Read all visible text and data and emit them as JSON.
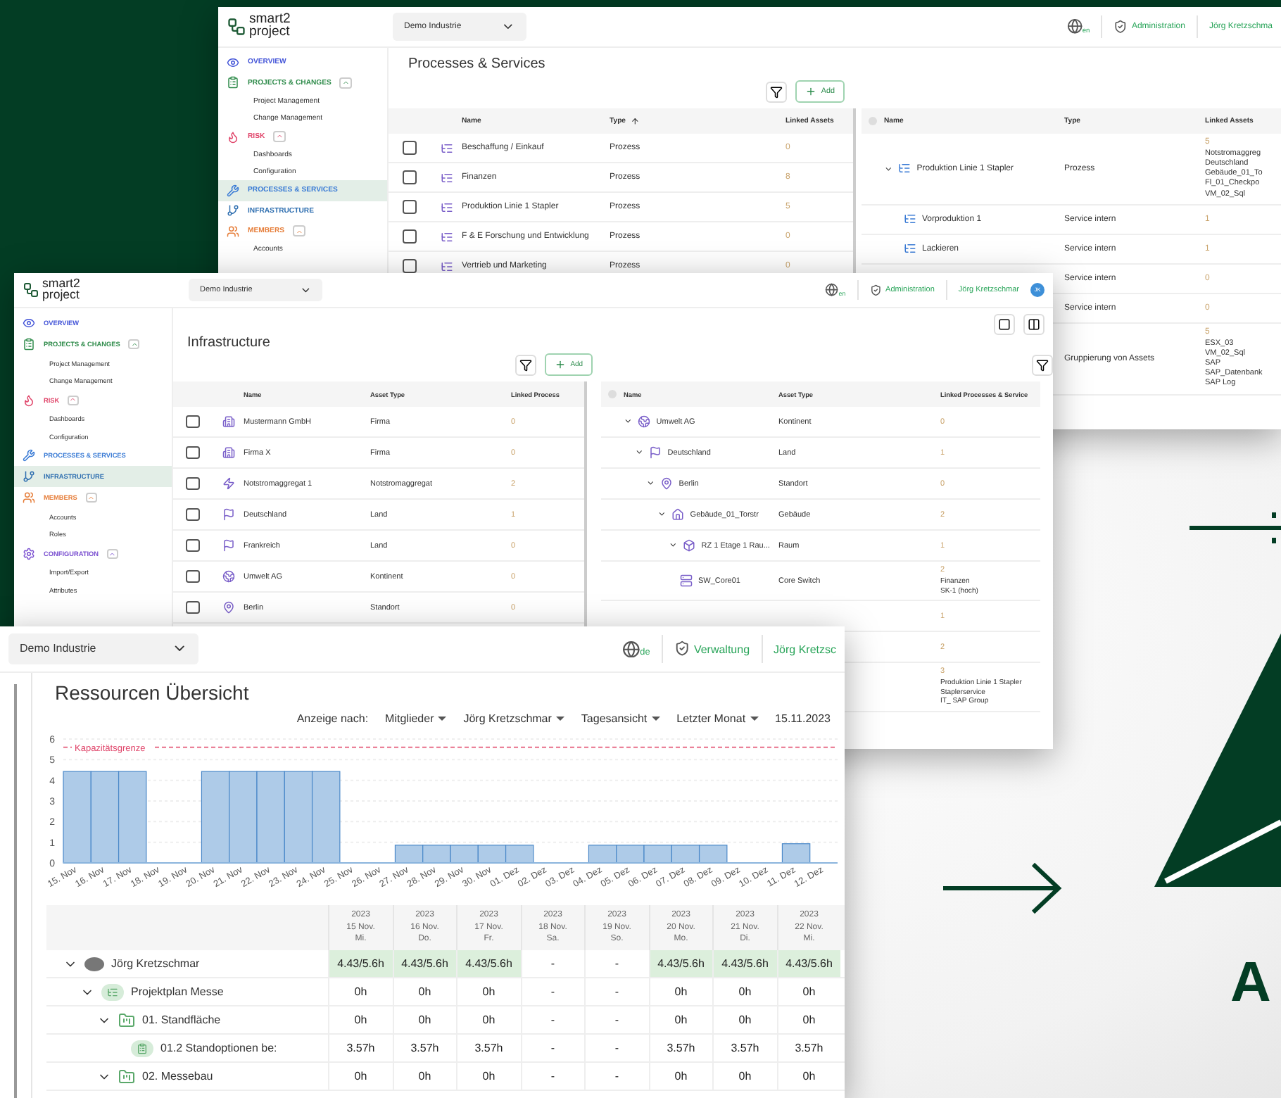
{
  "backdrop": {
    "brand_letter": "A"
  },
  "processes_window": {
    "topbar": {
      "logo": [
        "smart2",
        "project"
      ],
      "workspace": "Demo Industrie",
      "language": "en",
      "admin": "Administration",
      "user": "Jörg Kretzschma"
    },
    "sidebar": [
      {
        "label": "OVERVIEW",
        "color": "#4455d8",
        "selected": false
      },
      {
        "label": "PROJECTS & CHANGES",
        "color": "#2e8b4a",
        "selected": false,
        "expanded": true,
        "children": [
          {
            "label": "Project Management",
            "selected": false
          },
          {
            "label": "Change Management",
            "selected": false
          }
        ]
      },
      {
        "label": "RISK",
        "color": "#e0456a",
        "selected": false,
        "expanded": true,
        "children": [
          {
            "label": "Dashboards",
            "selected": false
          },
          {
            "label": "Configuration",
            "selected": false
          }
        ]
      },
      {
        "label": "PROCESSES & SERVICES",
        "color": "#3a7bd5",
        "selected": true
      },
      {
        "label": "INFRASTRUCTURE",
        "color": "#2f6fb0",
        "selected": false
      },
      {
        "label": "MEMBERS",
        "color": "#e67e3a",
        "selected": false,
        "expanded": true,
        "children": [
          {
            "label": "Accounts",
            "selected": false
          }
        ]
      }
    ],
    "title": "Processes & Services",
    "add_label": "Add",
    "left_table": {
      "columns": [
        {
          "label": "Name",
          "sorted": false
        },
        {
          "label": "Type",
          "sorted": true
        },
        {
          "label": "Linked Assets",
          "sorted": false
        }
      ],
      "rows": [
        {
          "checked": false,
          "name": "Beschaffung / Einkauf",
          "type": "Prozess",
          "linked": "0"
        },
        {
          "checked": false,
          "name": "Finanzen",
          "type": "Prozess",
          "linked": "8"
        },
        {
          "checked": false,
          "name": "Produktion Linie 1 Stapler",
          "type": "Prozess",
          "linked": "5"
        },
        {
          "checked": false,
          "name": "F & E Forschung und Entwicklung",
          "type": "Prozess",
          "linked": "0"
        },
        {
          "checked": false,
          "name": "Vertrieb und Marketing",
          "type": "Prozess",
          "linked": "0"
        }
      ]
    },
    "right_table": {
      "columns": [
        "Name",
        "Type",
        "Linked Assets"
      ],
      "rows": [
        {
          "kind": "process",
          "name": "Produktion Linie 1 Stapler",
          "type": "Prozess",
          "linked": "5",
          "linked_items": [
            "Notstromaggreg",
            "Deutschland",
            "Gebäude_01_To",
            "Fl_01_Checkpo",
            "VM_02_Sql"
          ],
          "expanded": true,
          "children": [
            {
              "kind": "service",
              "name": "Vorproduktion 1",
              "type": "Service intern",
              "linked": "1"
            },
            {
              "kind": "service",
              "name": "Lackieren",
              "type": "Service intern",
              "linked": "1"
            },
            {
              "kind": "hidden",
              "type": "Service intern",
              "linked": "0"
            },
            {
              "kind": "hidden",
              "type": "Service intern",
              "linked": "0"
            }
          ]
        },
        {
          "kind": "hidden",
          "type": "Gruppierung von Assets",
          "linked": "5",
          "linked_items": [
            "ESX_03",
            "VM_02_Sql",
            "SAP",
            "SAP_Datenbank",
            "SAP Log"
          ]
        }
      ]
    }
  },
  "infrastructure_window": {
    "topbar": {
      "logo": [
        "smart2",
        "project"
      ],
      "workspace": "Demo Industrie",
      "language": "en",
      "admin": "Administration",
      "user": "Jörg Kretzschmar",
      "avatar": "JK"
    },
    "sidebar": [
      {
        "label": "OVERVIEW",
        "color": "#4455d8",
        "selected": false
      },
      {
        "label": "PROJECTS & CHANGES",
        "color": "#2e8b4a",
        "selected": false,
        "expanded": true,
        "children": [
          {
            "label": "Project Management",
            "selected": false
          },
          {
            "label": "Change Management",
            "selected": false
          }
        ]
      },
      {
        "label": "RISK",
        "color": "#e0456a",
        "selected": false,
        "expanded": true,
        "children": [
          {
            "label": "Dashboards",
            "selected": false
          },
          {
            "label": "Configuration",
            "selected": false
          }
        ]
      },
      {
        "label": "PROCESSES & SERVICES",
        "color": "#3a7bd5",
        "selected": false
      },
      {
        "label": "INFRASTRUCTURE",
        "color": "#2f6fb0",
        "selected": true
      },
      {
        "label": "MEMBERS",
        "color": "#e67e3a",
        "selected": false,
        "expanded": true,
        "children": [
          {
            "label": "Accounts",
            "selected": false
          },
          {
            "label": "Roles",
            "selected": false
          }
        ]
      },
      {
        "label": "CONFIGURATION",
        "color": "#7a4fd0",
        "selected": false,
        "expanded": true,
        "children": [
          {
            "label": "Import/Export",
            "selected": false
          },
          {
            "label": "Attributes",
            "selected": false
          }
        ]
      }
    ],
    "title": "Infrastructure",
    "add_label": "Add",
    "left_table": {
      "columns": [
        {
          "label": "Name",
          "sorted": false
        },
        {
          "label": "Asset Type",
          "sorted": false
        },
        {
          "label": "Linked Process",
          "sorted": false
        }
      ],
      "rows": [
        {
          "checked": false,
          "kind": "company",
          "name": "Mustermann GmbH",
          "type": "Firma",
          "linked": "0"
        },
        {
          "checked": false,
          "kind": "company",
          "name": "Firma X",
          "type": "Firma",
          "linked": "0"
        },
        {
          "checked": false,
          "kind": "generator",
          "name": "Notstromaggregat 1",
          "type": "Notstromaggregat",
          "linked": "2"
        },
        {
          "checked": false,
          "kind": "country",
          "name": "Deutschland",
          "type": "Land",
          "linked": "1"
        },
        {
          "checked": false,
          "kind": "country",
          "name": "Frankreich",
          "type": "Land",
          "linked": "0"
        },
        {
          "checked": false,
          "kind": "continent",
          "name": "Umwelt AG",
          "type": "Kontinent",
          "linked": "0"
        },
        {
          "checked": false,
          "kind": "site",
          "name": "Berlin",
          "type": "Standort",
          "linked": "0"
        }
      ]
    },
    "right_table": {
      "columns": [
        "Name",
        "Asset Type",
        "Linked Processes & Service"
      ],
      "rows": [
        {
          "kind": "continent",
          "name": "Umwelt AG",
          "type": "Kontinent",
          "linked": "0",
          "expanded": true,
          "children": [
            {
              "kind": "country",
              "name": "Deutschland",
              "type": "Land",
              "linked": "1",
              "expanded": true,
              "children": [
                {
                  "kind": "site",
                  "name": "Berlin",
                  "type": "Standort",
                  "linked": "0",
                  "expanded": true,
                  "children": [
                    {
                      "kind": "building",
                      "name": "Gebäude_01_Torstr",
                      "type": "Gebäude",
                      "linked": "2",
                      "expanded": true,
                      "children": [
                        {
                          "kind": "room",
                          "name": "RZ 1 Etage 1 Rau...",
                          "type": "Raum",
                          "linked": "1",
                          "expanded": true,
                          "children": [
                            {
                              "kind": "switch",
                              "name": "SW_Core01",
                              "type": "Core Switch",
                              "linked": "2",
                              "linked_items": [
                                "Finanzen",
                                "SK-1 (hoch)"
                              ]
                            }
                          ]
                        }
                      ]
                    }
                  ]
                }
              ]
            }
          ]
        },
        {
          "kind": "hidden",
          "linked": "1"
        },
        {
          "kind": "hidden",
          "linked": "2"
        },
        {
          "kind": "hidden",
          "linked": "3",
          "linked_items": [
            "Produktion Linie 1 Stapler",
            "Staplerservice",
            "IT_ SAP Group"
          ]
        }
      ]
    }
  },
  "resources_window": {
    "topbar": {
      "workspace": "Demo Industrie",
      "language": "de",
      "admin": "Verwaltung",
      "user": "Jörg Kretzsc"
    },
    "title": "Ressourcen Übersicht",
    "filter_label": "Anzeige nach:",
    "filters": [
      {
        "label": "Mitglieder",
        "dropdown": true
      },
      {
        "label": "Jörg Kretzschmar",
        "dropdown": true
      },
      {
        "label": "Tagesansicht",
        "dropdown": true
      },
      {
        "label": "Letzter Monat",
        "dropdown": true
      },
      {
        "label": "15.11.2023",
        "dropdown": false
      }
    ],
    "chart_data": {
      "type": "bar",
      "categories": [
        "15. Nov",
        "16. Nov",
        "17. Nov",
        "18. Nov",
        "19. Nov",
        "20. Nov",
        "21. Nov",
        "22. Nov",
        "23. Nov",
        "24. Nov",
        "25. Nov",
        "26. Nov",
        "27. Nov",
        "28. Nov",
        "29. Nov",
        "30. Nov",
        "01. Dez",
        "02. Dez",
        "03. Dez",
        "04. Dez",
        "05. Dez",
        "06. Dez",
        "07. Dez",
        "08. Dez",
        "09. Dez",
        "10. Dez",
        "11. Dez",
        "12. Dez"
      ],
      "series": [
        {
          "color": "#aecbe8",
          "values": [
            4.43,
            4.43,
            4.43,
            0,
            0,
            4.43,
            4.43,
            4.43,
            4.43,
            4.43,
            0,
            0,
            0.86,
            0.86,
            0.86,
            0.86,
            0.86,
            0,
            0,
            0.86,
            0.86,
            0.86,
            0.86,
            0.86,
            0,
            0,
            0.93,
            0
          ]
        }
      ],
      "ylim": [
        0,
        6
      ],
      "yticks": [
        0,
        1,
        2,
        3,
        4,
        5,
        6
      ],
      "grid": true,
      "ref_lines": [
        {
          "axis": "y",
          "value": 5.6,
          "label": "Kapazitätsgrenze"
        }
      ]
    },
    "days": [
      {
        "year": "2023",
        "date": "15 Nov.",
        "weekday": "Mi.",
        "weekend": false
      },
      {
        "year": "2023",
        "date": "16 Nov.",
        "weekday": "Do.",
        "weekend": false
      },
      {
        "year": "2023",
        "date": "17 Nov.",
        "weekday": "Fr.",
        "weekend": false
      },
      {
        "year": "2023",
        "date": "18 Nov.",
        "weekday": "Sa.",
        "weekend": true
      },
      {
        "year": "2023",
        "date": "19 Nov.",
        "weekday": "So.",
        "weekend": true
      },
      {
        "year": "2023",
        "date": "20 Nov.",
        "weekday": "Mo.",
        "weekend": false
      },
      {
        "year": "2023",
        "date": "21 Nov.",
        "weekday": "Di.",
        "weekend": false
      },
      {
        "year": "2023",
        "date": "22 Nov.",
        "weekday": "Mi.",
        "weekend": false
      }
    ],
    "rows": [
      {
        "kind": "member",
        "name": "Jörg Kretzschmar",
        "expanded": true,
        "highlighted": true,
        "cells": [
          "4.43/5.6h",
          "4.43/5.6h",
          "4.43/5.6h",
          "-",
          "-",
          "4.43/5.6h",
          "4.43/5.6h",
          "4.43/5.6h"
        ],
        "children": [
          {
            "kind": "project",
            "name": "Projektplan Messe",
            "expanded": true,
            "highlighted": false,
            "cells": [
              "0h",
              "0h",
              "0h",
              "-",
              "-",
              "0h",
              "0h",
              "0h"
            ],
            "children": [
              {
                "kind": "phase",
                "name": "01. Standfläche",
                "expanded": true,
                "highlighted": false,
                "cells": [
                  "0h",
                  "0h",
                  "0h",
                  "-",
                  "-",
                  "0h",
                  "0h",
                  "0h"
                ],
                "children": [
                  {
                    "kind": "task",
                    "name": "01.2 Standoptionen be:",
                    "highlighted": false,
                    "cells": [
                      "3.57h",
                      "3.57h",
                      "3.57h",
                      "-",
                      "-",
                      "3.57h",
                      "3.57h",
                      "3.57h"
                    ]
                  }
                ]
              },
              {
                "kind": "phase",
                "name": "02. Messebau",
                "expanded": true,
                "highlighted": false,
                "cells": [
                  "0h",
                  "0h",
                  "0h",
                  "-",
                  "-",
                  "0h",
                  "0h",
                  "0h"
                ]
              }
            ]
          }
        ]
      }
    ]
  }
}
